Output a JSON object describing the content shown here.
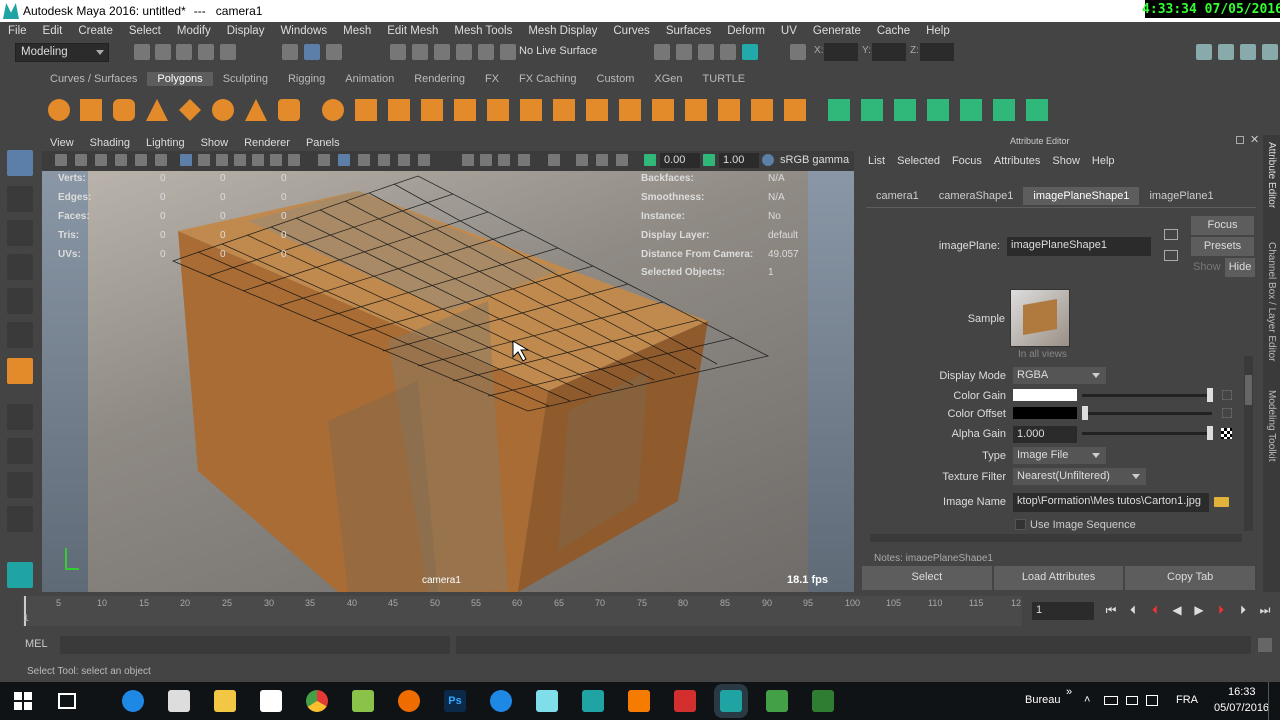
{
  "window": {
    "title": "Autodesk Maya 2016: untitled*",
    "sep": "---",
    "camera": "camera1"
  },
  "clock": {
    "time": "4:33:34",
    "date": "07/05/2016"
  },
  "menus": [
    "File",
    "Edit",
    "Create",
    "Select",
    "Modify",
    "Display",
    "Windows",
    "Mesh",
    "Edit Mesh",
    "Mesh Tools",
    "Mesh Display",
    "Curves",
    "Surfaces",
    "Deform",
    "UV",
    "Generate",
    "Cache",
    "Help"
  ],
  "status": {
    "mode": "Modeling",
    "live_surface": "No Live Surface",
    "x": "X:",
    "y": "Y:",
    "z": "Z:"
  },
  "shelf_tabs": [
    "Curves / Surfaces",
    "Polygons",
    "Sculpting",
    "Rigging",
    "Animation",
    "Rendering",
    "FX",
    "FX Caching",
    "Custom",
    "XGen",
    "TURTLE"
  ],
  "shelf_active": "Polygons",
  "viewport": {
    "menus": [
      "View",
      "Shading",
      "Lighting",
      "Show",
      "Renderer",
      "Panels"
    ],
    "exposure": "0.00",
    "gamma": "1.00",
    "colorspace": "sRGB gamma",
    "camera_label": "camera1",
    "fps": "18.1 fps",
    "hud_left": [
      {
        "label": "Verts:",
        "a": "0",
        "b": "0",
        "c": "0"
      },
      {
        "label": "Edges:",
        "a": "0",
        "b": "0",
        "c": "0"
      },
      {
        "label": "Faces:",
        "a": "0",
        "b": "0",
        "c": "0"
      },
      {
        "label": "Tris:",
        "a": "0",
        "b": "0",
        "c": "0"
      },
      {
        "label": "UVs:",
        "a": "0",
        "b": "0",
        "c": "0"
      }
    ],
    "hud_right": [
      {
        "label": "Backfaces:",
        "value": "N/A"
      },
      {
        "label": "Smoothness:",
        "value": "N/A"
      },
      {
        "label": "Instance:",
        "value": "No"
      },
      {
        "label": "Display Layer:",
        "value": "default"
      },
      {
        "label": "Distance From Camera:",
        "value": "49.057"
      },
      {
        "label": "Selected Objects:",
        "value": "1"
      }
    ]
  },
  "attribute_editor": {
    "title": "Attribute Editor",
    "menu": [
      "List",
      "Selected",
      "Focus",
      "Attributes",
      "Show",
      "Help"
    ],
    "tabs": [
      "camera1",
      "cameraShape1",
      "imagePlaneShape1",
      "imagePlane1"
    ],
    "active_tab": "imagePlaneShape1",
    "node_label": "imagePlane:",
    "node_value": "imagePlaneShape1",
    "focus": "Focus",
    "presets": "Presets",
    "show": "Show",
    "hide": "Hide",
    "sample_label": "Sample",
    "in_all_views": "In all views",
    "display_mode_label": "Display Mode",
    "display_mode": "RGBA",
    "color_gain_label": "Color Gain",
    "color_offset_label": "Color Offset",
    "alpha_gain_label": "Alpha Gain",
    "alpha_gain": "1.000",
    "type_label": "Type",
    "type": "Image File",
    "texture_filter_label": "Texture Filter",
    "texture_filter": "Nearest(Unfiltered)",
    "image_name_label": "Image Name",
    "image_name": "ktop\\Formation\\Mes tutos\\Carton1.jpg",
    "use_sequence": "Use Image Sequence",
    "notes": "Notes:  imagePlaneShape1",
    "buttons": [
      "Select",
      "Load Attributes",
      "Copy Tab"
    ],
    "side_tabs": [
      "Attribute Editor",
      "Channel Box / Layer Editor",
      "Modeling Toolkit"
    ]
  },
  "timeline": {
    "ticks": [
      "1",
      "5",
      "10",
      "15",
      "20",
      "25",
      "30",
      "35",
      "40",
      "45",
      "50",
      "55",
      "60",
      "65",
      "70",
      "75",
      "80",
      "85",
      "90",
      "95",
      "100",
      "105",
      "110",
      "115",
      "12"
    ],
    "current_frame": "1"
  },
  "mel": {
    "label": "MEL"
  },
  "help_line": "Select Tool: select an object",
  "taskbar": {
    "bureau": "Bureau",
    "lang": "FRA",
    "time": "16:33",
    "date": "05/07/2016"
  }
}
